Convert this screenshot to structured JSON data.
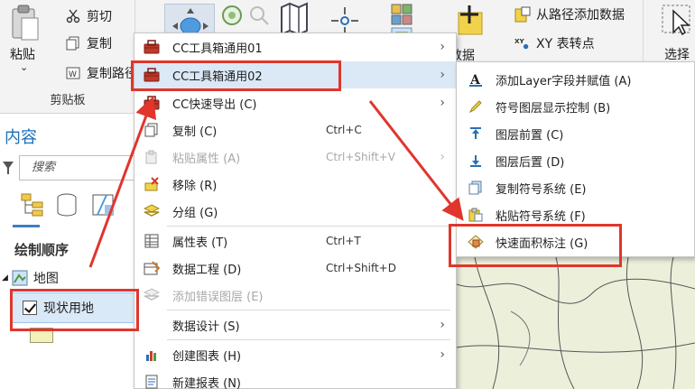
{
  "ribbon": {
    "paste_label": "粘贴",
    "paste_arrow": "⌄",
    "cut_label": "剪切",
    "copy_label": "复制",
    "copy_path_label": "复制路径",
    "clipboard_group_label": "剪贴板",
    "add_data_label": "加数据",
    "add_from_path_label": "从路径添加数据",
    "xy_to_point_label": "XY 表转点",
    "select_label": "选择"
  },
  "contents": {
    "title": "内容",
    "search_placeholder": "搜索",
    "draw_order": "绘制顺序",
    "map_label": "地图",
    "layer_label": "现状用地"
  },
  "context_menu": {
    "items": [
      {
        "label": "CC工具箱通用01",
        "shortcut": "",
        "submenu": true,
        "icon": "toolbox-icon",
        "disabled": false
      },
      {
        "label": "CC工具箱通用02",
        "shortcut": "",
        "submenu": true,
        "icon": "toolbox-icon",
        "disabled": false
      },
      {
        "label": "CC快速导出 (C)",
        "shortcut": "",
        "submenu": true,
        "icon": "toolbox-icon",
        "disabled": false
      },
      {
        "label": "复制 (C)",
        "shortcut": "Ctrl+C",
        "submenu": false,
        "icon": "copy-icon",
        "disabled": false
      },
      {
        "label": "粘贴属性 (A)",
        "shortcut": "Ctrl+Shift+V",
        "submenu": true,
        "icon": "paste-properties-icon",
        "disabled": true
      },
      {
        "label": "移除 (R)",
        "shortcut": "",
        "submenu": false,
        "icon": "remove-icon",
        "disabled": false
      },
      {
        "label": "分组 (G)",
        "shortcut": "",
        "submenu": false,
        "icon": "group-icon",
        "disabled": false
      },
      {
        "label": "属性表 (T)",
        "shortcut": "Ctrl+T",
        "submenu": false,
        "icon": "attribute-table-icon",
        "disabled": false
      },
      {
        "label": "数据工程 (D)",
        "shortcut": "Ctrl+Shift+D",
        "submenu": false,
        "icon": "data-engineering-icon",
        "disabled": false
      },
      {
        "label": "添加错误图层 (E)",
        "shortcut": "",
        "submenu": false,
        "icon": "error-layer-icon",
        "disabled": true
      },
      {
        "label": "数据设计 (S)",
        "shortcut": "",
        "submenu": true,
        "icon": "",
        "disabled": false
      },
      {
        "label": "创建图表 (H)",
        "shortcut": "",
        "submenu": true,
        "icon": "chart-icon",
        "disabled": false
      },
      {
        "label": "新建报表 (N)",
        "shortcut": "",
        "submenu": false,
        "icon": "report-icon",
        "disabled": false
      }
    ]
  },
  "submenu": {
    "items": [
      {
        "label": "添加Layer字段并赋值 (A)",
        "icon": "text-field-icon"
      },
      {
        "label": "符号图层显示控制 (B)",
        "icon": "symbol-pen-icon"
      },
      {
        "label": "图层前置 (C)",
        "icon": "bring-forward-icon"
      },
      {
        "label": "图层后置 (D)",
        "icon": "send-backward-icon"
      },
      {
        "label": "复制符号系统 (E)",
        "icon": "copy-symbology-icon"
      },
      {
        "label": "粘贴符号系统 (F)",
        "icon": "paste-symbology-icon"
      },
      {
        "label": "快速面积标注 (G)",
        "icon": "area-label-icon"
      }
    ]
  },
  "colors": {
    "highlight_box": "#e0362c",
    "menu_hover": "#dbe8f5",
    "accent": "#1a6fb8"
  }
}
